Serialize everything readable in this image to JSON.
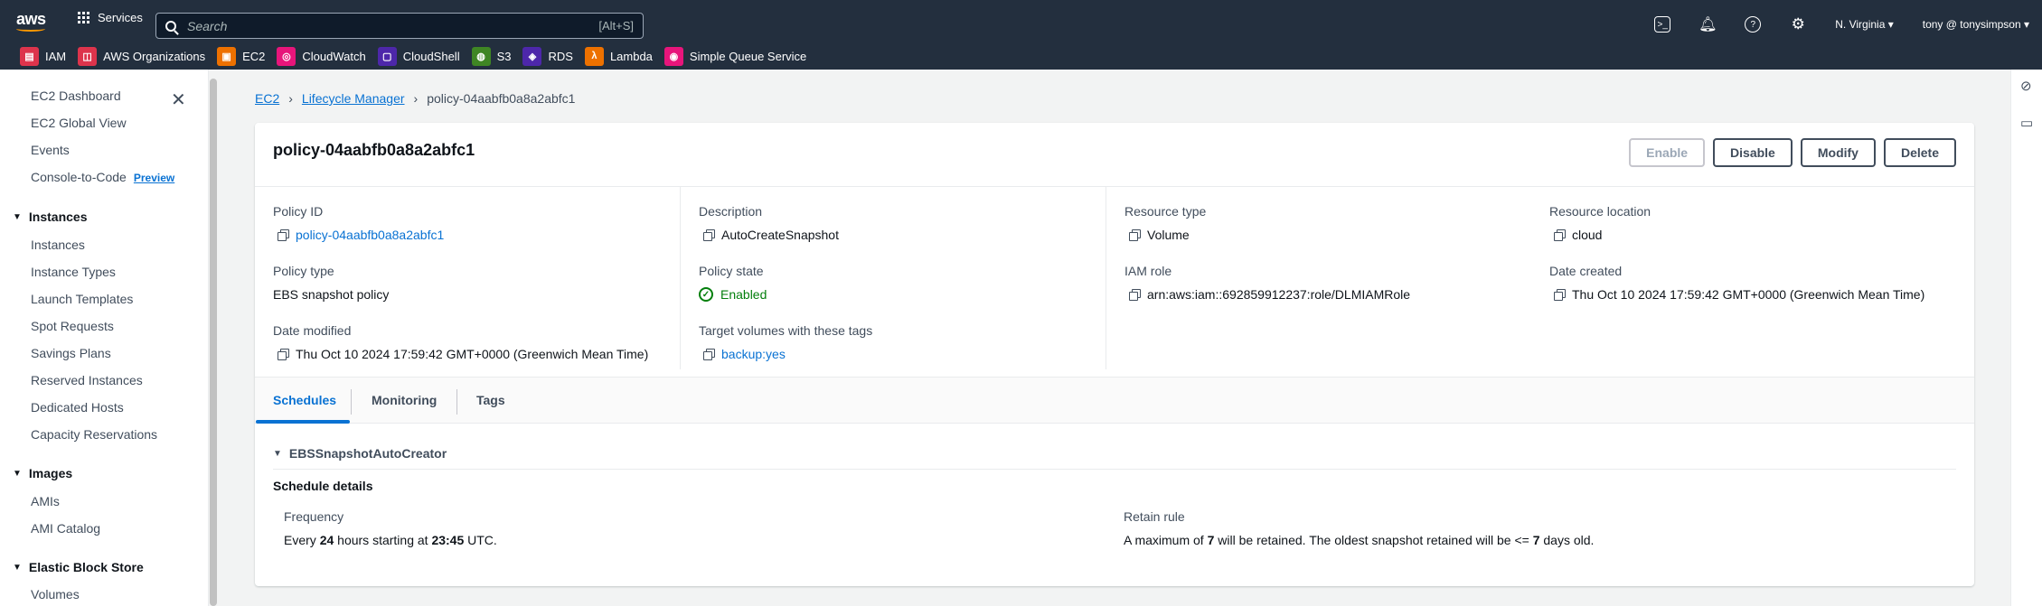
{
  "topbar": {
    "logo": "aws",
    "services": "Services",
    "search_placeholder": "Search",
    "search_shortcut": "[Alt+S]",
    "region": "N. Virginia ▾",
    "user": "tony @ tonysimpson ▾"
  },
  "favorites": [
    {
      "label": "IAM",
      "color": "#dd344c",
      "icon": "iam-icon"
    },
    {
      "label": "AWS Organizations",
      "color": "#dd344c",
      "icon": "organizations-icon"
    },
    {
      "label": "EC2",
      "color": "#ed7100",
      "icon": "ec2-icon"
    },
    {
      "label": "CloudWatch",
      "color": "#e7157b",
      "icon": "cloudwatch-icon"
    },
    {
      "label": "CloudShell",
      "color": "#4d27aa",
      "icon": "cloudshell-icon"
    },
    {
      "label": "S3",
      "color": "#3f8624",
      "icon": "s3-icon"
    },
    {
      "label": "RDS",
      "color": "#4d27aa",
      "icon": "rds-icon"
    },
    {
      "label": "Lambda",
      "color": "#ed7100",
      "icon": "lambda-icon"
    },
    {
      "label": "Simple Queue Service",
      "color": "#e7157b",
      "icon": "sqs-icon"
    }
  ],
  "sidebar": {
    "dashboard": "EC2 Dashboard",
    "global_view": "EC2 Global View",
    "events": "Events",
    "console_to_code": "Console-to-Code",
    "preview": "Preview",
    "instances_head": "Instances",
    "instances": "Instances",
    "instance_types": "Instance Types",
    "launch_templates": "Launch Templates",
    "spot_requests": "Spot Requests",
    "savings_plans": "Savings Plans",
    "reserved_instances": "Reserved Instances",
    "dedicated_hosts": "Dedicated Hosts",
    "capacity_reservations": "Capacity Reservations",
    "images_head": "Images",
    "amis": "AMIs",
    "ami_catalog": "AMI Catalog",
    "ebs_head": "Elastic Block Store",
    "volumes": "Volumes"
  },
  "breadcrumb": {
    "ec2": "EC2",
    "lifecycle": "Lifecycle Manager",
    "current": "policy-04aabfb0a8a2abfc1"
  },
  "policy": {
    "title": "policy-04aabfb0a8a2abfc1",
    "buttons": {
      "enable": "Enable",
      "disable": "Disable",
      "modify": "Modify",
      "delete": "Delete"
    },
    "policy_id_label": "Policy ID",
    "policy_id": "policy-04aabfb0a8a2abfc1",
    "description_label": "Description",
    "description": "AutoCreateSnapshot",
    "resource_type_label": "Resource type",
    "resource_type": "Volume",
    "resource_location_label": "Resource location",
    "resource_location": "cloud",
    "policy_type_label": "Policy type",
    "policy_type": "EBS snapshot policy",
    "policy_state_label": "Policy state",
    "policy_state": "Enabled",
    "iam_role_label": "IAM role",
    "iam_role": "arn:aws:iam::692859912237:role/DLMIAMRole",
    "date_created_label": "Date created",
    "date_created": "Thu Oct 10 2024 17:59:42 GMT+0000 (Greenwich Mean Time)",
    "date_modified_label": "Date modified",
    "date_modified": "Thu Oct 10 2024 17:59:42 GMT+0000 (Greenwich Mean Time)",
    "target_tags_label": "Target volumes with these tags",
    "target_tags": "backup:yes"
  },
  "tabs": [
    "Schedules",
    "Monitoring",
    "Tags"
  ],
  "schedule": {
    "name": "EBSSnapshotAutoCreator",
    "details_heading": "Schedule details",
    "frequency_label": "Frequency",
    "freq_every": "Every",
    "freq_hours": "24",
    "freq_mid": "hours starting at",
    "freq_time": "23:45",
    "freq_tail": "UTC.",
    "retain_label": "Retain rule",
    "retain_a": "A maximum of",
    "retain_count": "7",
    "retain_b": "will be retained. The oldest snapshot retained will be <=",
    "retain_days": "7",
    "retain_c": "days old."
  }
}
